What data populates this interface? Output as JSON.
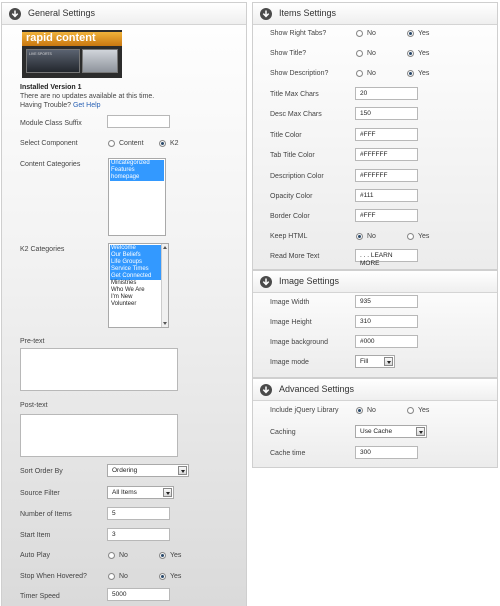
{
  "general": {
    "title": "General Settings",
    "logo_text": "rapid content",
    "logo_caption": "LIVE SPORTS",
    "installed_version": "Installed Version 1",
    "no_updates": "There are no updates available at this time.",
    "trouble_text": "Having Trouble?",
    "help_link": "Get Help",
    "module_class_suffix": {
      "label": "Module Class Suffix",
      "value": ""
    },
    "select_component": {
      "label": "Select Component",
      "options": [
        "Content",
        "K2"
      ],
      "selected": "K2"
    },
    "content_categories": {
      "label": "Content Categories",
      "items": [
        "Uncategorized",
        "Features",
        "homepage"
      ],
      "selected": [
        0,
        1,
        2
      ]
    },
    "k2_categories": {
      "label": "K2 Categories",
      "items": [
        "Welcome",
        "Our Beliefs",
        "Life Groups",
        "Service Times",
        "Get Connected",
        "Ministries",
        "Who We Are",
        "I'm New",
        "Volunteer"
      ],
      "selected": [
        0,
        1,
        2,
        3,
        4
      ]
    },
    "pre_text": {
      "label": "Pre-text",
      "value": ""
    },
    "post_text": {
      "label": "Post-text",
      "value": ""
    },
    "sort_order": {
      "label": "Sort Order By",
      "value": "Ordering"
    },
    "source_filter": {
      "label": "Source Filter",
      "value": "All Items"
    },
    "number_items": {
      "label": "Number of Items",
      "value": "5"
    },
    "start_item": {
      "label": "Start Item",
      "value": "3"
    },
    "auto_play": {
      "label": "Auto Play",
      "options": [
        "No",
        "Yes"
      ],
      "selected": "Yes"
    },
    "stop_hover": {
      "label": "Stop When Hovered?",
      "options": [
        "No",
        "Yes"
      ],
      "selected": "Yes"
    },
    "timer_speed": {
      "label": "Timer Speed",
      "value": "5000"
    }
  },
  "items": {
    "title": "Items Settings",
    "show_right_tabs": {
      "label": "Show Right Tabs?",
      "options": [
        "No",
        "Yes"
      ],
      "selected": "Yes"
    },
    "show_title": {
      "label": "Show Title?",
      "options": [
        "No",
        "Yes"
      ],
      "selected": "Yes"
    },
    "show_description": {
      "label": "Show Description?",
      "options": [
        "No",
        "Yes"
      ],
      "selected": "Yes"
    },
    "title_max_chars": {
      "label": "Title Max Chars",
      "value": "20"
    },
    "desc_max_chars": {
      "label": "Desc Max Chars",
      "value": "150"
    },
    "title_color": {
      "label": "Title Color",
      "value": "#FFF"
    },
    "tab_title_color": {
      "label": "Tab Title Color",
      "value": "#FFFFFF"
    },
    "description_color": {
      "label": "Description Color",
      "value": "#FFFFFF"
    },
    "opacity_color": {
      "label": "Opacity Color",
      "value": "#111"
    },
    "border_color": {
      "label": "Border Color",
      "value": "#FFF"
    },
    "keep_html": {
      "label": "Keep HTML",
      "options": [
        "No",
        "Yes"
      ],
      "selected": "No"
    },
    "read_more_text": {
      "label": "Read More Text",
      "value": ". . . LEARN MORE"
    }
  },
  "image": {
    "title": "Image Settings",
    "width": {
      "label": "Image Width",
      "value": "935"
    },
    "height": {
      "label": "Image Height",
      "value": "310"
    },
    "background": {
      "label": "Image background",
      "value": "#000"
    },
    "mode": {
      "label": "Image mode",
      "value": "Fill"
    }
  },
  "advanced": {
    "title": "Advanced Settings",
    "jquery": {
      "label": "Include jQuery Library",
      "options": [
        "No",
        "Yes"
      ],
      "selected": "No"
    },
    "caching": {
      "label": "Caching",
      "value": "Use Cache"
    },
    "cache_time": {
      "label": "Cache time",
      "value": "300"
    }
  },
  "colors": {
    "selection": "#3399ff",
    "link": "#2a62b5",
    "logo_band": "#f0b23a",
    "header_icon": "#4a4a4a"
  },
  "icons": {
    "panel_header": "circle-down-arrow-icon"
  }
}
